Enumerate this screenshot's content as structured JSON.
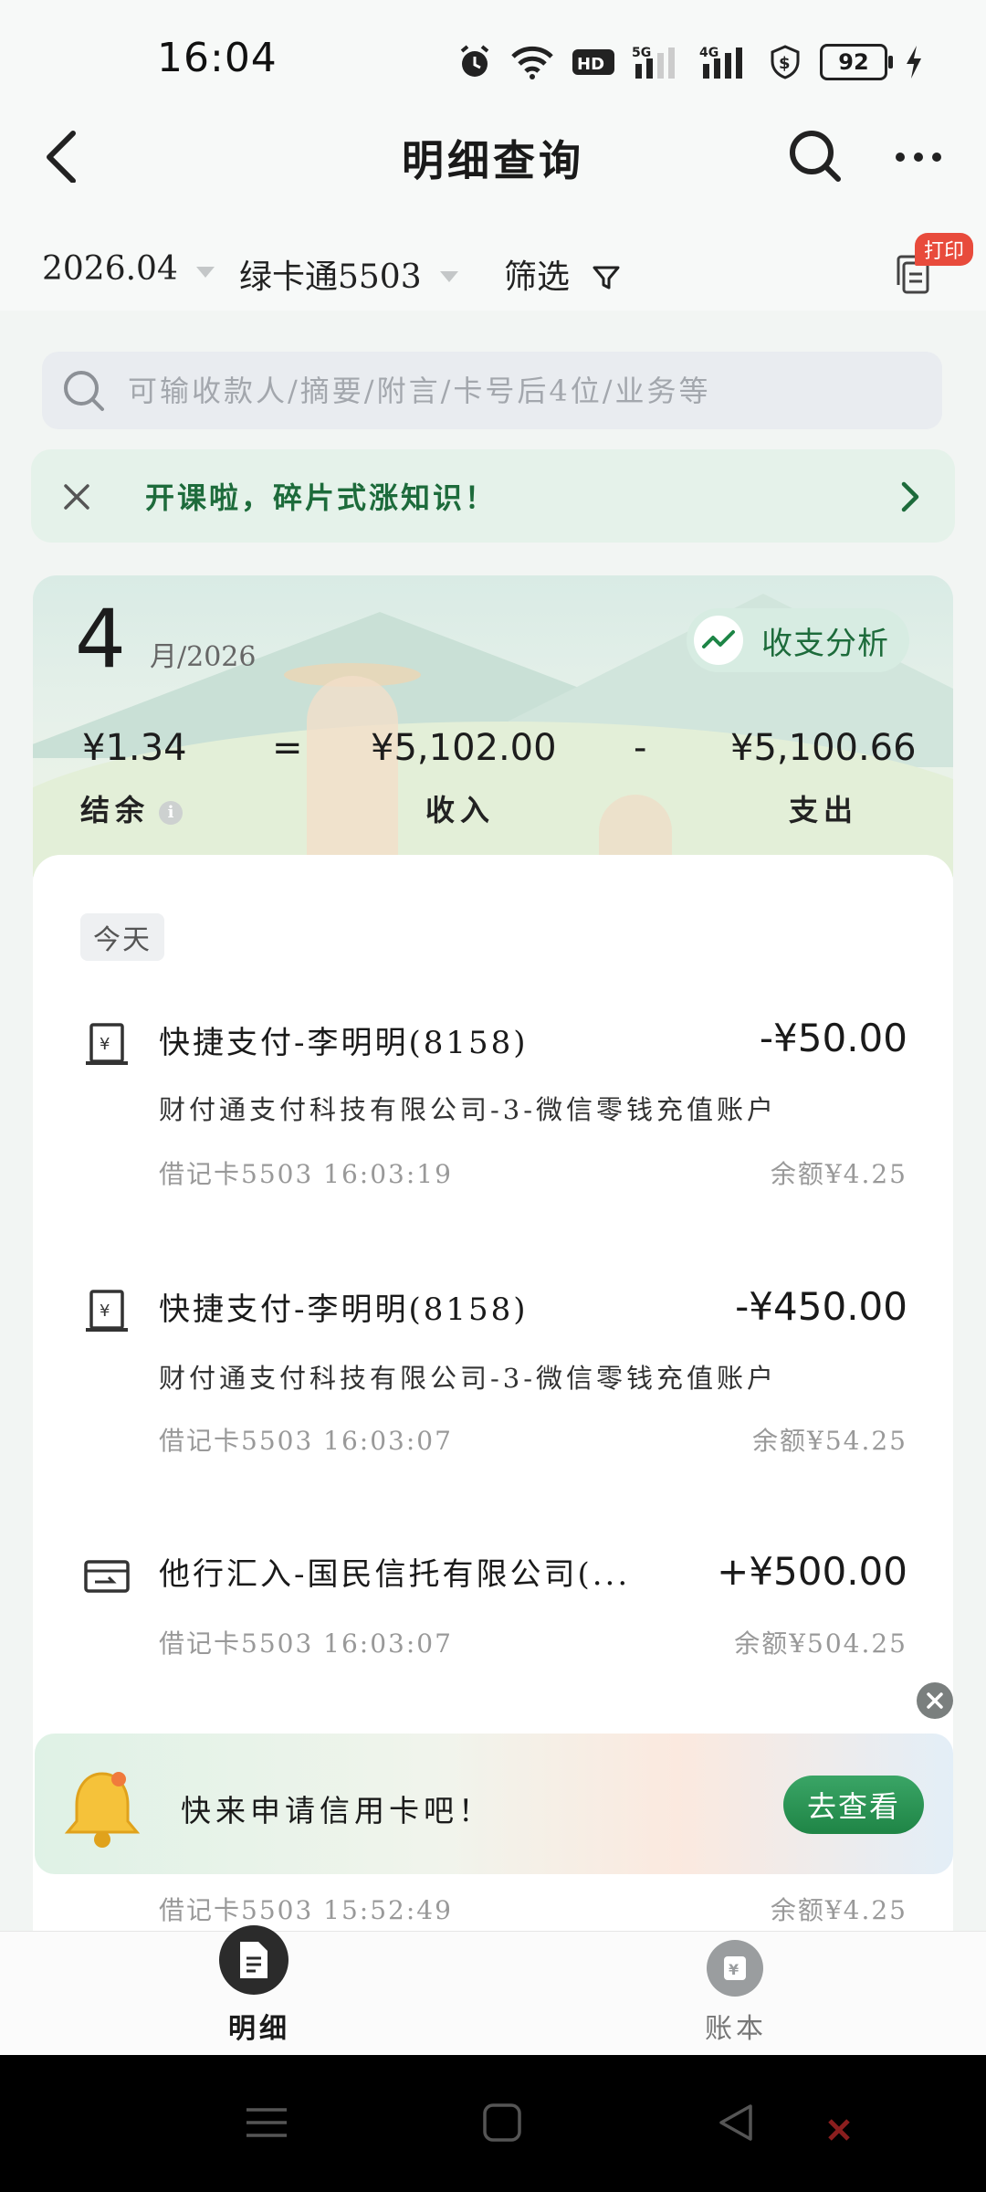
{
  "status_bar": {
    "time": "16:04",
    "battery": "92"
  },
  "header": {
    "title": "明细查询"
  },
  "filters": {
    "month": "2026.04",
    "card": "绿卡通5503",
    "filter_label": "筛选",
    "print_badge": "打印"
  },
  "search": {
    "placeholder": "可输收款人/摘要/附言/卡号后4位/业务等"
  },
  "promo": {
    "text": "开课啦，碎片式涨知识！"
  },
  "summary": {
    "month": "4",
    "month_suffix": "月/2026",
    "analysis_label": "收支分析",
    "balance": "¥1.34",
    "equals": "=",
    "income": "¥5,102.00",
    "minus": "-",
    "expense": "¥5,100.66",
    "balance_label": "结余",
    "income_label": "收入",
    "expense_label": "支出"
  },
  "list": {
    "today_label": "今天",
    "transactions": [
      {
        "title": "快捷支付-李明明(8158)",
        "desc": "财付通支付科技有限公司-3-微信零钱充值账户",
        "meta": "借记卡5503  16:03:19",
        "amount": "-¥50.00",
        "balance": "余额¥4.25"
      },
      {
        "title": "快捷支付-李明明(8158)",
        "desc": "财付通支付科技有限公司-3-微信零钱充值账户",
        "meta": "借记卡5503  16:03:07",
        "amount": "-¥450.00",
        "balance": "余额¥54.25"
      },
      {
        "title": "他行汇入-国民信托有限公司(...",
        "meta": "借记卡5503  16:03:07",
        "amount": "+¥500.00",
        "balance": "余额¥504.25"
      },
      {
        "meta": "借记卡5503  15:52:49",
        "balance": "余额¥4.25"
      }
    ]
  },
  "credit_banner": {
    "text": "快来申请信用卡吧！",
    "button": "去查看"
  },
  "bottom_nav": {
    "detail": "明细",
    "ledger": "账本"
  }
}
